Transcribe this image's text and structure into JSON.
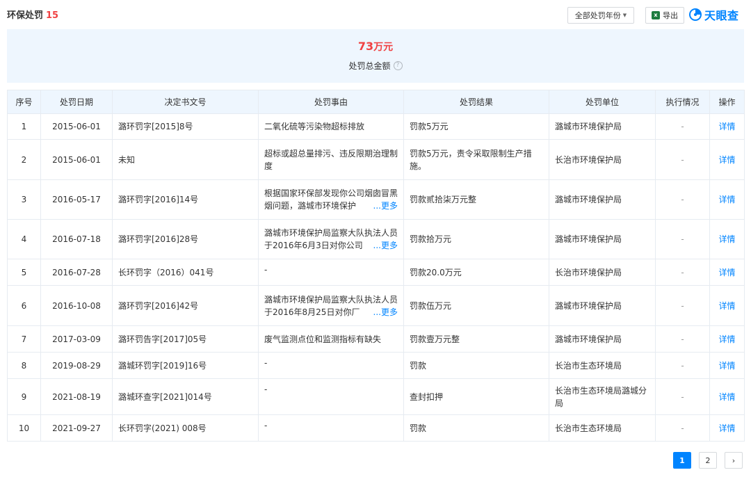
{
  "header": {
    "title": "环保处罚",
    "count": "15",
    "year_filter_label": "全部处罚年份",
    "export_label": "导出",
    "brand": "天眼查"
  },
  "summary": {
    "amount": "73",
    "unit": "万元",
    "label": "处罚总金额",
    "help": "?"
  },
  "columns": [
    "序号",
    "处罚日期",
    "决定书文号",
    "处罚事由",
    "处罚结果",
    "处罚单位",
    "执行情况",
    "操作"
  ],
  "rows": [
    {
      "no": "1",
      "date": "2015-06-01",
      "doc": "潞环罚字[2015]8号",
      "reason": "二氧化硫等污染物超标排放",
      "more": "",
      "result": "罚款5万元",
      "unit": "潞城市环境保护局",
      "status": "-",
      "action": "详情"
    },
    {
      "no": "2",
      "date": "2015-06-01",
      "doc": "未知",
      "reason": "超标或超总量排污、违反限期治理制度",
      "more": "",
      "result": "罚款5万元，责令采取限制生产措施。",
      "unit": "长治市环境保护局",
      "status": "-",
      "action": "详情"
    },
    {
      "no": "3",
      "date": "2016-05-17",
      "doc": "潞环罚字[2016]14号",
      "reason": "根据国家环保部发现你公司烟囱冒黑烟问题，潞城市环境保护",
      "more": "...更多",
      "result": "罚款贰拾柒万元整",
      "unit": "潞城市环境保护局",
      "status": "-",
      "action": "详情"
    },
    {
      "no": "4",
      "date": "2016-07-18",
      "doc": "潞环罚字[2016]28号",
      "reason": "潞城市环境保护局监察大队执法人员于2016年6月3日对你公司",
      "more": "...更多",
      "result": "罚款拾万元",
      "unit": "潞城市环境保护局",
      "status": "-",
      "action": "详情"
    },
    {
      "no": "5",
      "date": "2016-07-28",
      "doc": "长环罚字（2016）041号",
      "reason": "-",
      "more": "",
      "result": "罚款20.0万元",
      "unit": "长治市环境保护局",
      "status": "-",
      "action": "详情"
    },
    {
      "no": "6",
      "date": "2016-10-08",
      "doc": "潞环罚字[2016]42号",
      "reason": "潞城市环境保护局监察大队执法人员于2016年8月25日对你厂",
      "more": "...更多",
      "result": "罚款伍万元",
      "unit": "潞城市环境保护局",
      "status": "-",
      "action": "详情"
    },
    {
      "no": "7",
      "date": "2017-03-09",
      "doc": "潞环罚告字[2017]05号",
      "reason": "废气监测点位和监测指标有缺失",
      "more": "",
      "result": "罚款壹万元整",
      "unit": "潞城市环境保护局",
      "status": "-",
      "action": "详情"
    },
    {
      "no": "8",
      "date": "2019-08-29",
      "doc": "潞城环罚字[2019]16号",
      "reason": "-",
      "more": "",
      "result": "罚款",
      "unit": "长治市生态环境局",
      "status": "-",
      "action": "详情"
    },
    {
      "no": "9",
      "date": "2021-08-19",
      "doc": "潞城环查字[2021]014号",
      "reason": "-",
      "more": "",
      "result": "查封扣押",
      "unit": "长治市生态环境局潞城分局",
      "status": "-",
      "action": "详情"
    },
    {
      "no": "10",
      "date": "2021-09-27",
      "doc": "长环罚字(2021) 008号",
      "reason": "-",
      "more": "",
      "result": "罚款",
      "unit": "长治市生态环境局",
      "status": "-",
      "action": "详情"
    }
  ],
  "pagination": {
    "pages": [
      "1",
      "2"
    ],
    "current": "1",
    "next": "›"
  },
  "colors": {
    "accent": "#0084ff",
    "danger": "#f04142",
    "header_bg": "#eef6fe"
  }
}
